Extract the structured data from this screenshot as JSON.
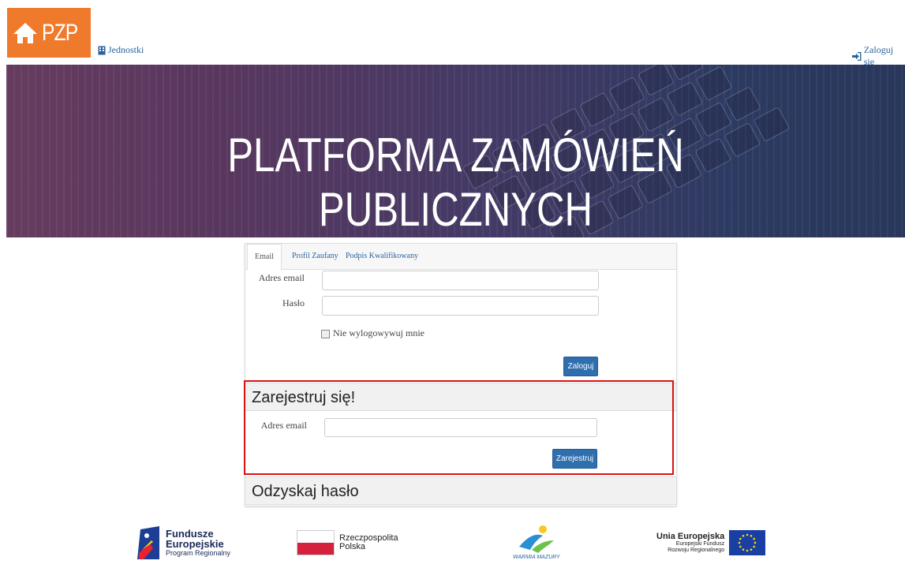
{
  "nav": {
    "logo_text": "PZP",
    "units_label": "Jednostki",
    "login_label": "Zaloguj się"
  },
  "hero": {
    "title": "PLATFORMA ZAMÓWIEŃ PUBLICZNYCH"
  },
  "login": {
    "tabs": [
      {
        "label": "Email"
      },
      {
        "label": "Profil Zaufany"
      },
      {
        "label": "Podpis Kwalifikowany"
      }
    ],
    "email_label": "Adres email",
    "email_value": "",
    "password_label": "Hasło",
    "password_value": "",
    "remember_label": "Nie wylogowywuj mnie",
    "remember_checked": false,
    "submit_label": "Zaloguj"
  },
  "register": {
    "heading": "Zarejestruj się!",
    "email_label": "Adres email",
    "email_value": "",
    "submit_label": "Zarejestruj"
  },
  "recover": {
    "heading": "Odzyskaj hasło"
  },
  "footer": {
    "fe": {
      "line1": "Fundusze",
      "line2": "Europejskie",
      "line3": "Program Regionalny"
    },
    "rp": {
      "line1": "Rzeczpospolita",
      "line2": "Polska"
    },
    "wm": {
      "text": "WARMIA MAZURY"
    },
    "eu": {
      "line1": "Unia Europejska",
      "line2": "Europejski Fundusz",
      "line3": "Rozwoju Regionalnego"
    }
  },
  "colors": {
    "accent": "#f07a2c",
    "link": "#2a63a0",
    "button": "#2f6fae",
    "highlight": "#dd1111"
  }
}
